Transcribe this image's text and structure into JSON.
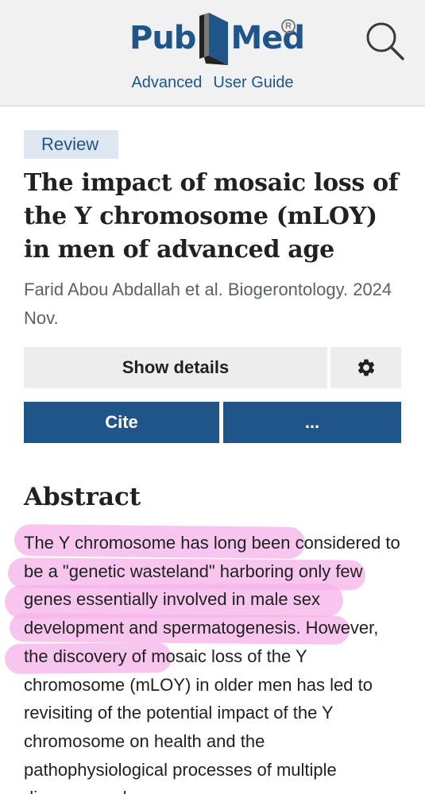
{
  "header": {
    "logo_left": "Pub",
    "logo_right": "Med",
    "reg_mark": "R",
    "links": [
      "Advanced",
      "User Guide"
    ],
    "search_icon": "search-icon",
    "colors": {
      "brand": "#20558a",
      "background": "#f1f1f1"
    }
  },
  "article": {
    "type_badge": "Review",
    "title": "The impact of mosaic loss of the Y chromosome (mLOY) in men of advanced age",
    "authors_line": "Farid Abou Abdallah et al. Biogerontology. 2024 Nov."
  },
  "actions": {
    "show_details": "Show details",
    "settings_icon": "gear-icon",
    "cite": "Cite",
    "more": "...",
    "colors": {
      "primary": "#20558a",
      "secondary": "#ededed"
    }
  },
  "abstract": {
    "heading": "Abstract",
    "highlighted": "The Y chromosome has long been considered to be a \"genetic wasteland\" harboring only few genes essentially involved in male sex development and spermatogenesis",
    "rest": ". However, the discovery of mosaic loss of the Y chromosome (mLOY) in older men has led to revisiting of the potential impact of the Y chromosome on health and the pathophysiological processes of multiple diseases and"
  },
  "annotation": {
    "highlight_color": "#f6b2ea"
  }
}
